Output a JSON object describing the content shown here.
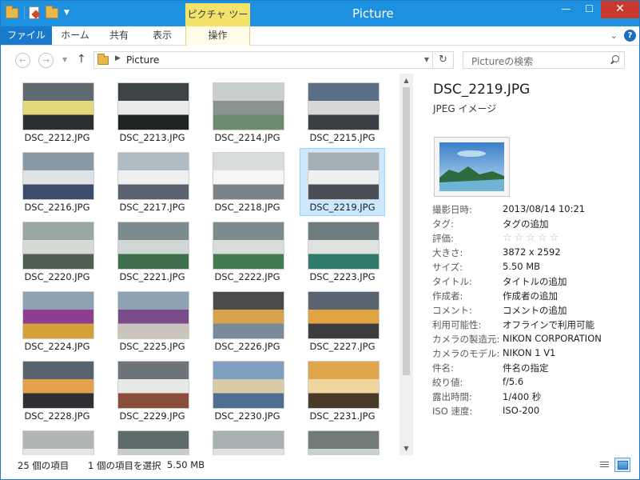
{
  "window": {
    "title": "Picture",
    "contextual_tab": "ピクチャ ツール",
    "controls": {
      "minimize": "—",
      "maximize": "☐",
      "close": "✕"
    }
  },
  "ribbon": {
    "tabs": [
      "ファイル",
      "ホーム",
      "共有",
      "表示",
      "操作"
    ],
    "help": "?"
  },
  "navigation": {
    "back": "←",
    "forward": "→",
    "up": "↑",
    "address_path": "Picture",
    "refresh": "↻",
    "search_placeholder": "Pictureの検索"
  },
  "files": [
    {
      "name": "DSC_2212.JPG",
      "palette": [
        "#5f6a6e",
        "#e6d67a",
        "#2a2f33"
      ]
    },
    {
      "name": "DSC_2213.JPG",
      "palette": [
        "#3e4446",
        "#e8ebe7",
        "#1e2324"
      ]
    },
    {
      "name": "DSC_2214.JPG",
      "palette": [
        "#c9d0cc",
        "#8a9390",
        "#6a8b6e"
      ]
    },
    {
      "name": "DSC_2215.JPG",
      "palette": [
        "#5a6f86",
        "#d8d9d6",
        "#3b3f43"
      ]
    },
    {
      "name": "DSC_2216.JPG",
      "palette": [
        "#8a9aa5",
        "#dfe3e6",
        "#3b4c6b"
      ]
    },
    {
      "name": "DSC_2217.JPG",
      "palette": [
        "#b2bcc3",
        "#eef0f0",
        "#5a6070"
      ]
    },
    {
      "name": "DSC_2218.JPG",
      "palette": [
        "#d8dcdc",
        "#f5f6f5",
        "#7c8386"
      ]
    },
    {
      "name": "DSC_2219.JPG",
      "palette": [
        "#a3aeb5",
        "#eef0ef",
        "#4a4f56"
      ]
    },
    {
      "name": "DSC_2220.JPG",
      "palette": [
        "#9aa7a4",
        "#d6dad5",
        "#4e5e4f"
      ]
    },
    {
      "name": "DSC_2221.JPG",
      "palette": [
        "#7b8b8e",
        "#cfd6d3",
        "#3f6e4d"
      ]
    },
    {
      "name": "DSC_2222.JPG",
      "palette": [
        "#7b8b8e",
        "#d9ddd9",
        "#437a52"
      ]
    },
    {
      "name": "DSC_2223.JPG",
      "palette": [
        "#6e7c7e",
        "#dfe3e0",
        "#2f7a6a"
      ]
    },
    {
      "name": "DSC_2224.JPG",
      "palette": [
        "#8ea2b4",
        "#8c3f8f",
        "#d6a13a"
      ]
    },
    {
      "name": "DSC_2225.JPG",
      "palette": [
        "#8ea2b4",
        "#7a4a8a",
        "#c9c4bd"
      ]
    },
    {
      "name": "DSC_2226.JPG",
      "palette": [
        "#4a4a4a",
        "#d9a24c",
        "#7a8a9a"
      ]
    },
    {
      "name": "DSC_2227.JPG",
      "palette": [
        "#5a6470",
        "#e0a542",
        "#3d3d3d"
      ]
    },
    {
      "name": "DSC_2228.JPG",
      "palette": [
        "#57646d",
        "#e2a14a",
        "#2e2f33"
      ]
    },
    {
      "name": "DSC_2229.JPG",
      "palette": [
        "#6d7478",
        "#e7e9e6",
        "#8a4d3a"
      ]
    },
    {
      "name": "DSC_2230.JPG",
      "palette": [
        "#7f9fc0",
        "#d9cba8",
        "#4d6f92"
      ]
    },
    {
      "name": "DSC_2231.JPG",
      "palette": [
        "#e0a64c",
        "#f0d7a0",
        "#4a3a2a"
      ]
    },
    {
      "name": "",
      "palette": [
        "#b0b6b5",
        "#e4e6e3",
        "#7a8384"
      ]
    },
    {
      "name": "",
      "palette": [
        "#5f6a6a",
        "#c9cdc8",
        "#2f3637"
      ]
    },
    {
      "name": "",
      "palette": [
        "#a7b0b2",
        "#dfe2df",
        "#566064"
      ]
    },
    {
      "name": "",
      "palette": [
        "#6f7a79",
        "#cbd1cd",
        "#394345"
      ]
    }
  ],
  "selected_index": 7,
  "details": {
    "filename": "DSC_2219.JPG",
    "filetype": "JPEG イメージ",
    "properties": [
      {
        "key": "撮影日時:",
        "value": "2013/08/14 10:21"
      },
      {
        "key": "タグ:",
        "value": "タグの追加"
      },
      {
        "key": "評価:",
        "value": "",
        "rating_stars": 5,
        "rating_filled": 0
      },
      {
        "key": "大きさ:",
        "value": "3872 x 2592"
      },
      {
        "key": "サイズ:",
        "value": "5.50 MB"
      },
      {
        "key": "タイトル:",
        "value": "タイトルの追加"
      },
      {
        "key": "作成者:",
        "value": "作成者の追加"
      },
      {
        "key": "コメント:",
        "value": "コメントの追加"
      },
      {
        "key": "利用可能性:",
        "value": "オフラインで利用可能"
      },
      {
        "key": "カメラの製造元:",
        "value": "NIKON CORPORATION"
      },
      {
        "key": "カメラのモデル:",
        "value": "NIKON 1 V1"
      },
      {
        "key": "件名:",
        "value": "件名の指定"
      },
      {
        "key": "絞り値:",
        "value": "f/5.6"
      },
      {
        "key": "露出時間:",
        "value": "1/400 秒"
      },
      {
        "key": "ISO 速度:",
        "value": "ISO-200"
      }
    ]
  },
  "statusbar": {
    "item_count": "25 個の項目",
    "selection": "1 個の項目を選択",
    "selection_size": "5.50 MB"
  },
  "colors": {
    "titlebar": "#1d91e0",
    "file_tab": "#1979ca",
    "contextual": "#f4e36b",
    "selection": "#cce8ff"
  }
}
